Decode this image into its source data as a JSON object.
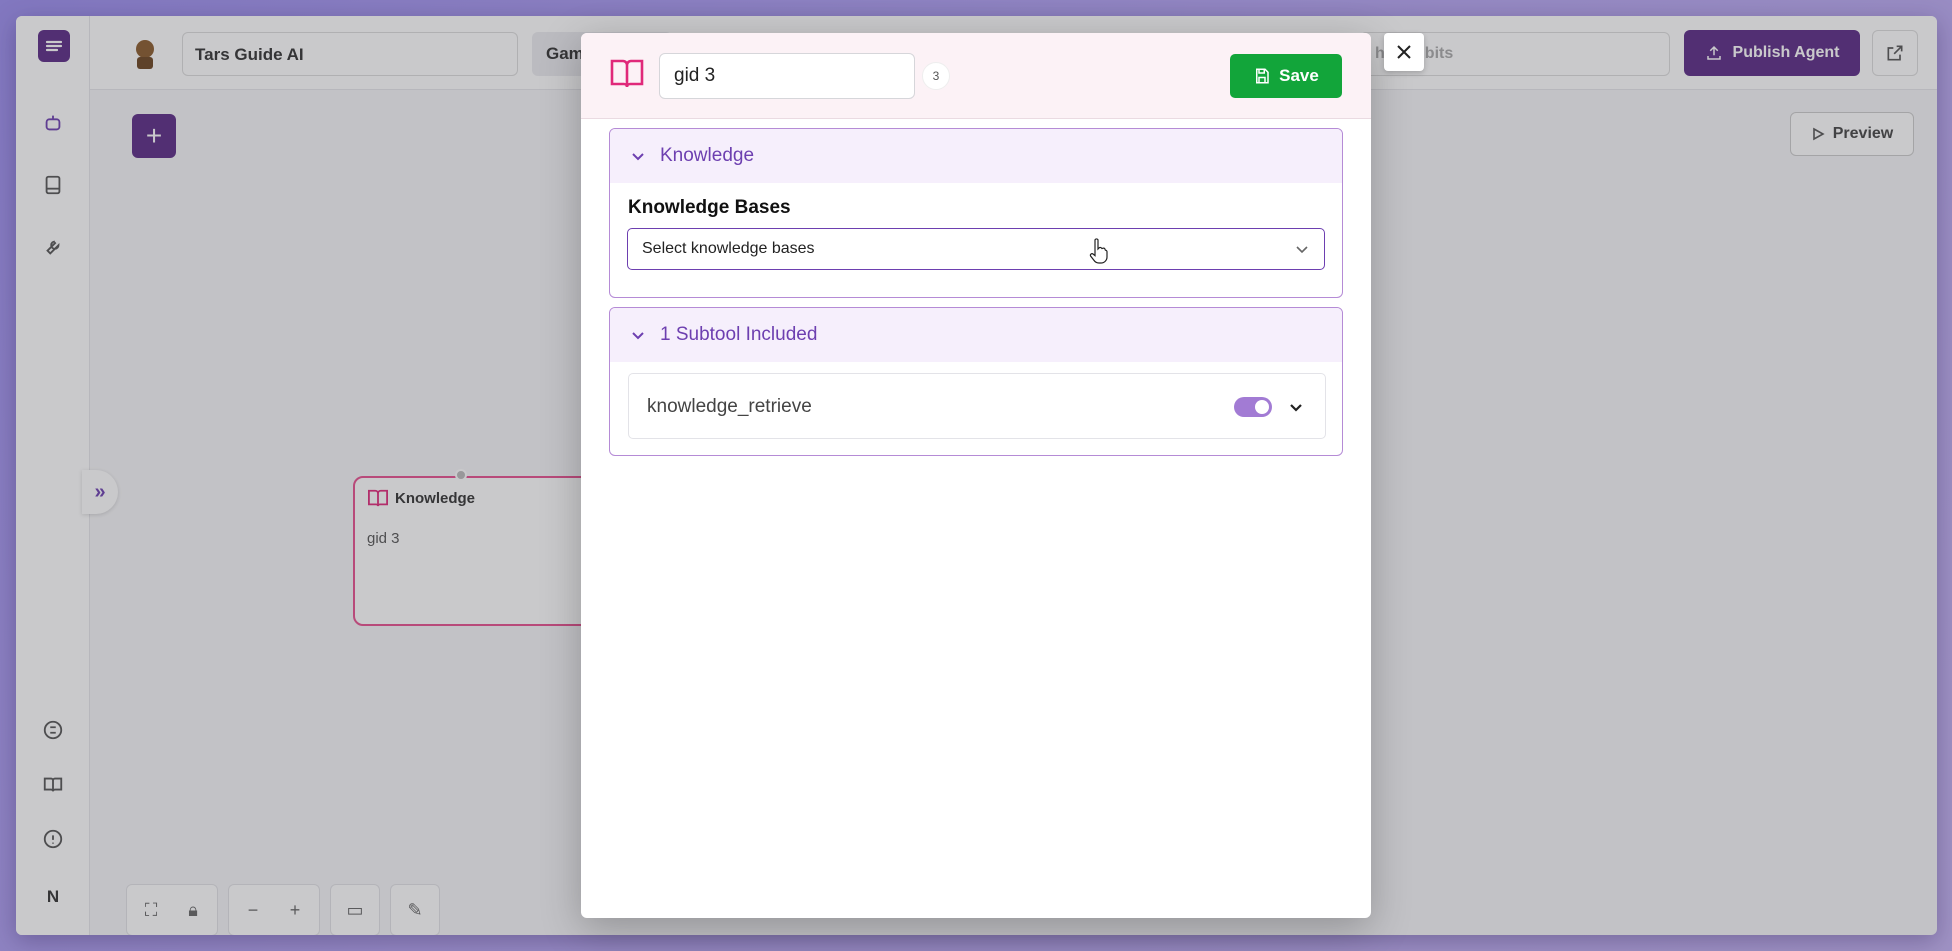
{
  "app": {
    "agent_name": "Tars Guide AI",
    "gambit_tab": "Gam",
    "search_placeholder": "h Gambits",
    "publish_label": "Publish Agent",
    "preview_label": "Preview",
    "user_initial": "N",
    "accent": "#5b2a86"
  },
  "node": {
    "title": "Knowledge",
    "text": "gid 3"
  },
  "modal": {
    "name_value": "gid 3",
    "count": "3",
    "save_label": "Save",
    "knowledge_section": {
      "title": "Knowledge",
      "field_label": "Knowledge Bases",
      "select_placeholder": "Select knowledge bases"
    },
    "subtools_section": {
      "title": "1 Subtool Included",
      "items": [
        {
          "name": "knowledge_retrieve",
          "enabled": true
        }
      ]
    }
  },
  "colors": {
    "save_green": "#12a53a",
    "section_purple": "#6d3fb0",
    "book_pink": "#e0297a"
  }
}
